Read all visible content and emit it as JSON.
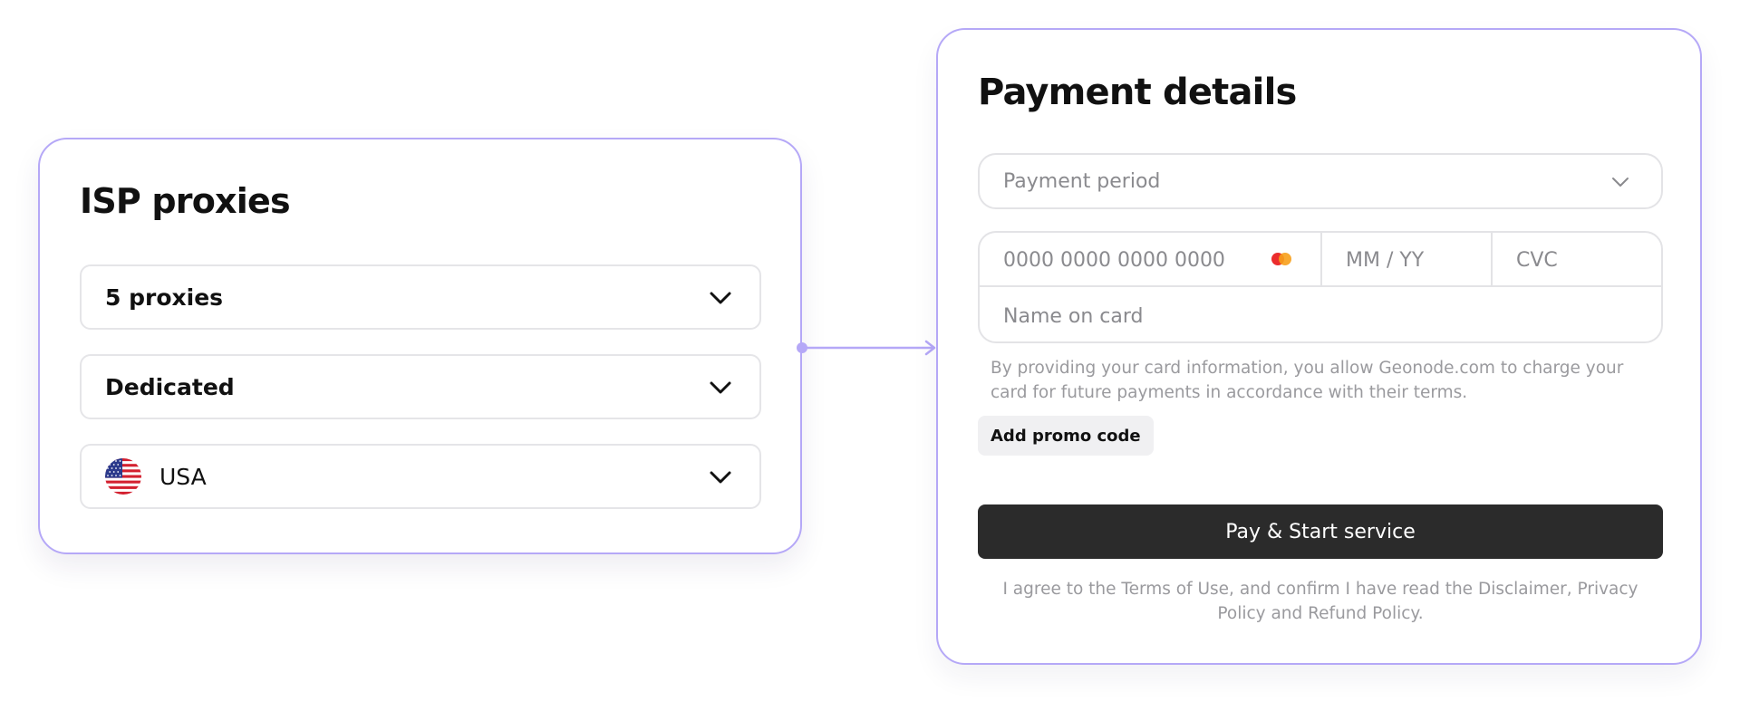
{
  "isp": {
    "title": "ISP proxies",
    "quantity_select": {
      "value": "5 proxies",
      "icon": "chevron-down-icon"
    },
    "type_select": {
      "value": "Dedicated",
      "icon": "chevron-down-icon"
    },
    "country_select": {
      "value": "USA",
      "flag_icon": "us-flag-icon",
      "icon": "chevron-down-icon"
    }
  },
  "payment": {
    "title": "Payment details",
    "period_select": {
      "placeholder": "Payment period",
      "icon": "chevron-down-icon"
    },
    "card": {
      "number_placeholder": "0000 0000 0000 0000",
      "brand_icon": "mastercard-icon",
      "expiry_placeholder": "MM / YY",
      "cvc_placeholder": "CVC",
      "name_placeholder": "Name on card"
    },
    "consent_text": "By providing your card information, you allow Geonode.com to charge your card for future payments in accordance with their terms.",
    "promo_label": "Add promo code",
    "submit_label": "Pay & Start service",
    "terms_text": "I agree to the Terms of Use, and confirm I have read the Disclaimer, Privacy Policy and Refund Policy."
  },
  "colors": {
    "accent": "#b5a8f7",
    "button_dark": "#2b2b2b",
    "muted_text": "#9a9a9e",
    "border": "#e3e3e6"
  }
}
